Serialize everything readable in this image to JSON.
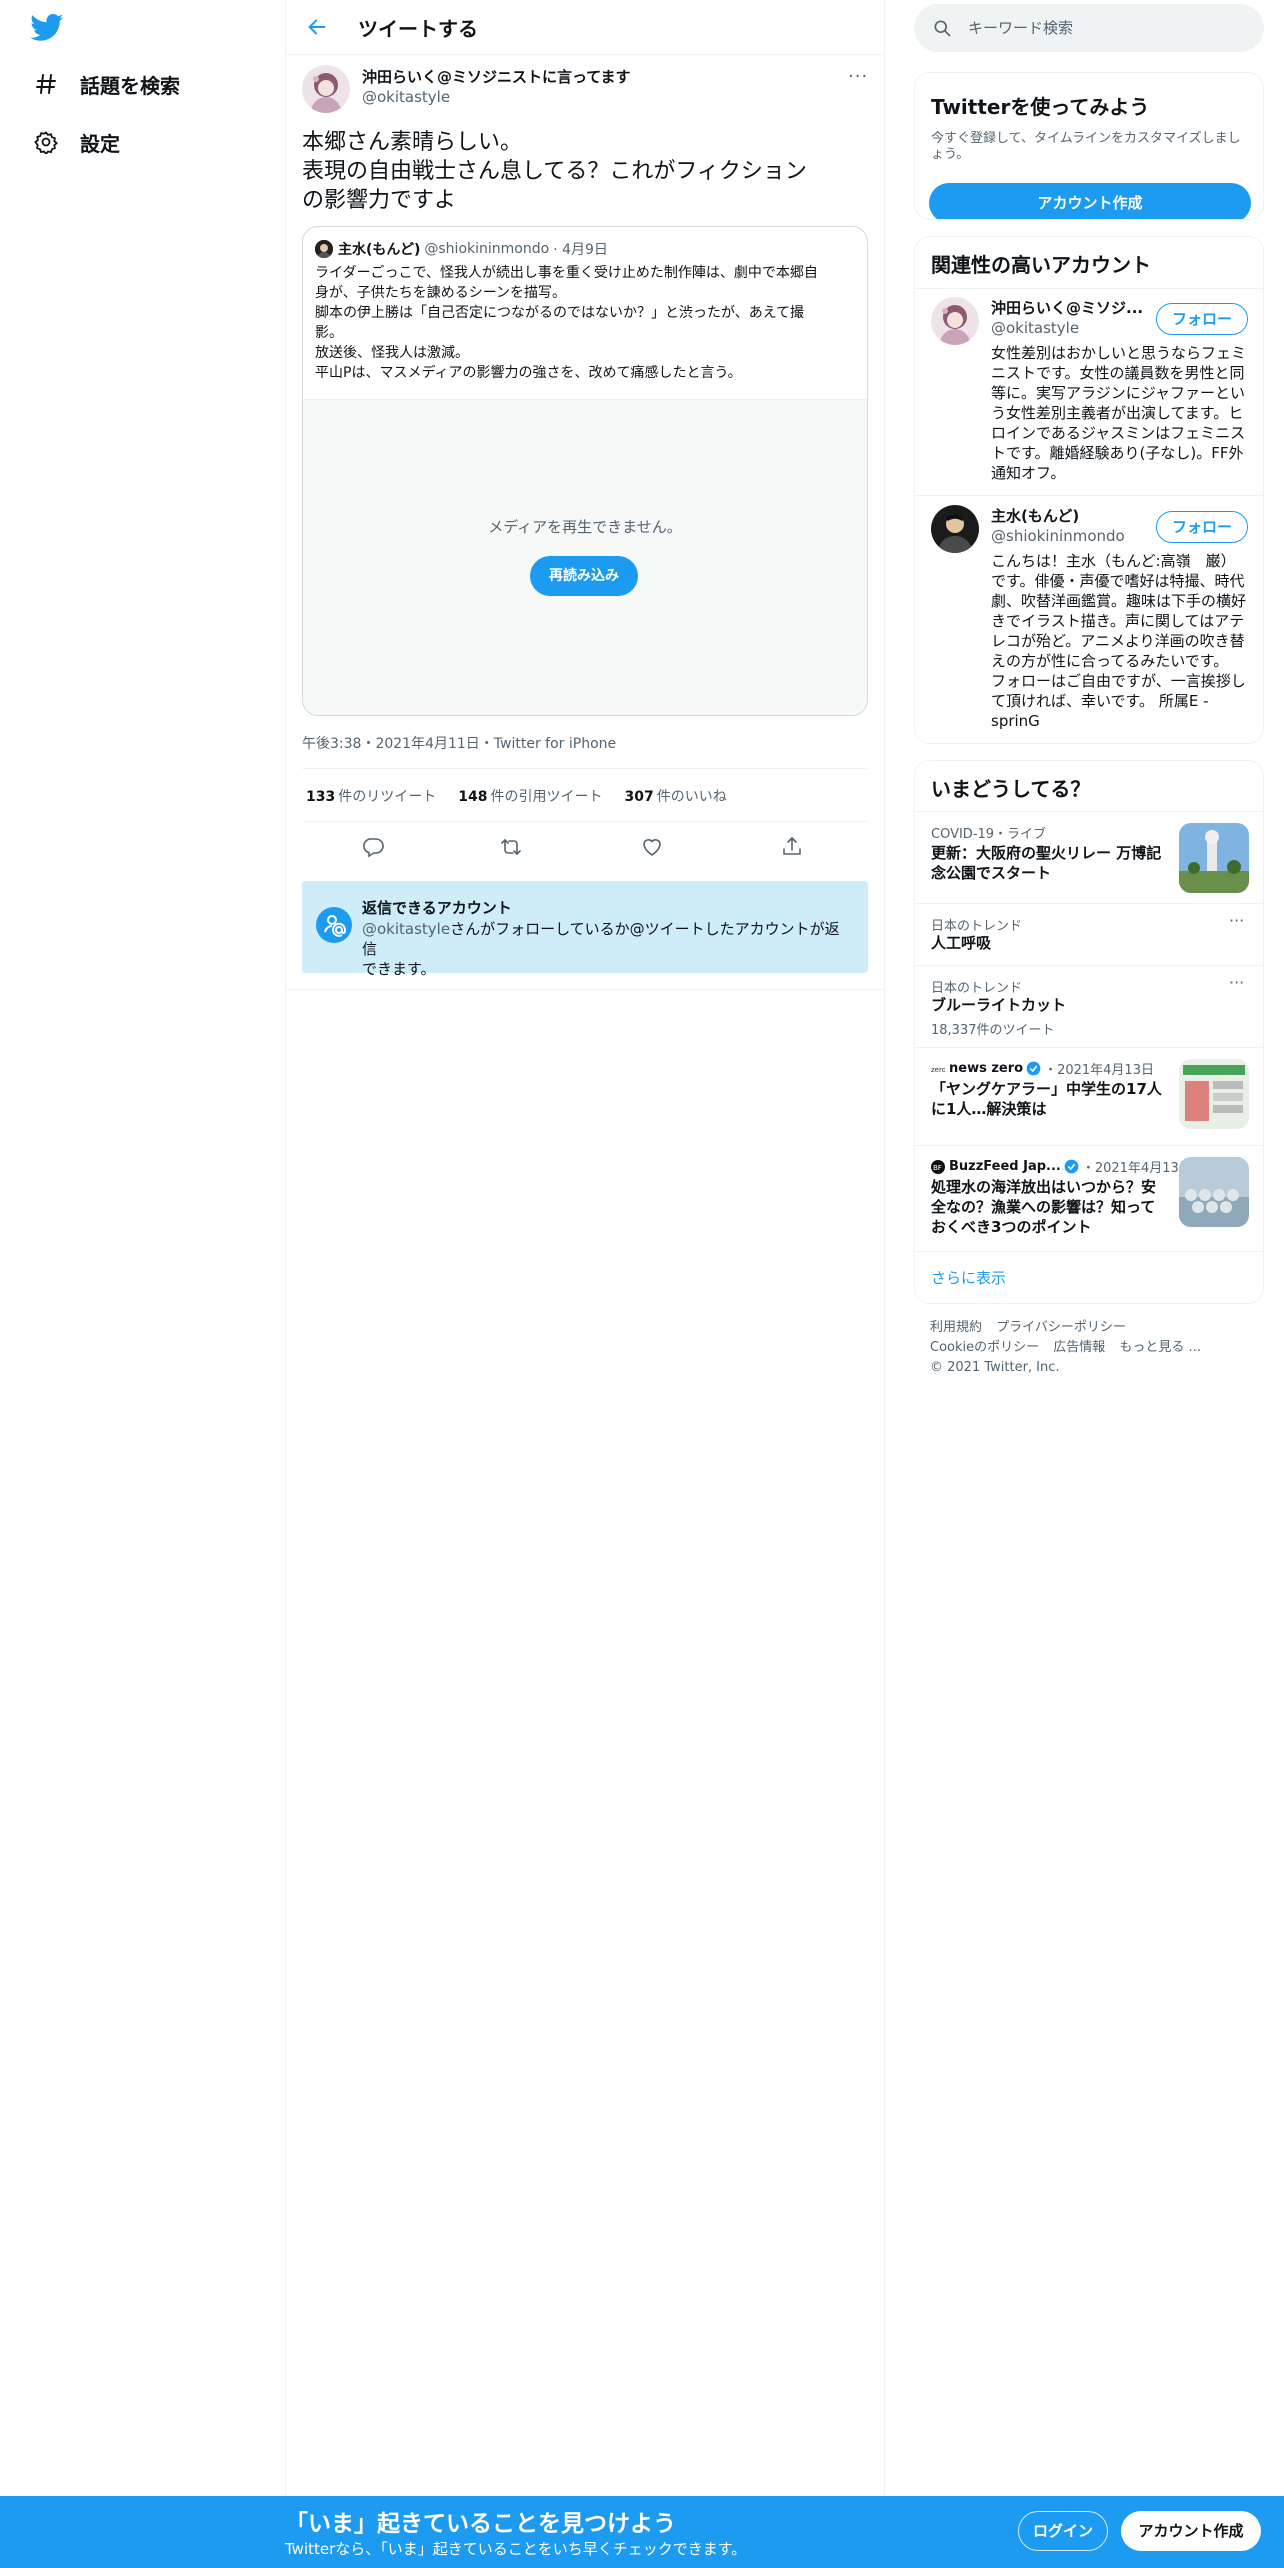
{
  "nav": {
    "items": [
      {
        "label": "話題を検索"
      },
      {
        "label": "設定"
      }
    ]
  },
  "header": {
    "title": "ツイートする"
  },
  "tweet": {
    "author_name": "沖田らいく@ミソジニストに言ってます",
    "author_handle": "@okitastyle",
    "more": "···",
    "text_lines": [
      "本郷さん素晴らしい。",
      "表現の自由戦士さん息してる？これがフィクション",
      "の影響力ですよ"
    ],
    "quote": {
      "name": "主水(もんど)",
      "handle": "@shiokininmondo",
      "date": "· 4月9日",
      "text_lines": [
        "ライダーごっこで、怪我人が続出し事を重く受け止めた制作陣は、劇中で本郷自",
        "身が、子供たちを諌めるシーンを描写。",
        "脚本の伊上勝は「自己否定につながるのではないか？」と渋ったが、あえて撮",
        "影。",
        "放送後、怪我人は激減。",
        "平山Pは、マスメディアの影響力の強さを、改めて痛感したと言う。"
      ],
      "media_message": "メディアを再生できません。",
      "reload_label": "再読み込み"
    },
    "meta": "午後3:38・2021年4月11日・Twitter for iPhone",
    "stats": {
      "retweets": "133",
      "retweets_label": "件のリツイート",
      "quotes": "148",
      "quotes_label": "件の引用ツイート",
      "likes": "307",
      "likes_label": "件のいいね"
    },
    "reply_box": {
      "title": "返信できるアカウント",
      "handle": "@okitastyle",
      "desc_rest": "さんがフォローしているか@ツイートしたアカウントが返信",
      "desc_line2": "できます。"
    }
  },
  "search": {
    "placeholder": "キーワード検索"
  },
  "signup_card": {
    "title": "Twitterを使ってみよう",
    "desc": "今すぐ登録して、タイムラインをカスタマイズしましょう。",
    "button": "アカウント作成"
  },
  "related": {
    "title": "関連性の高いアカウント",
    "follow_label": "フォロー",
    "accounts": [
      {
        "name": "沖田らいく@ミソジ...",
        "handle": "@okitastyle",
        "bio_lines": [
          "女性差別はおかしいと思うならフェミ",
          "ニストです。女性の議員数を男性と同",
          "等に。実写アラジンにジャファーとい",
          "う女性差別主義者が出演してます。ヒ",
          "ロインであるジャスミンはフェミニス",
          "トです。離婚経験あり(子なし)。FF外",
          "通知オフ。"
        ]
      },
      {
        "name": "主水(もんど)",
        "handle": "@shiokininmondo",
        "bio_lines": [
          "こんちは！主水（もんど:高嶺　巌）",
          "です。俳優・声優で嗜好は特撮、時代",
          "劇、吹替洋画鑑賞。趣味は下手の横好",
          "きでイラスト描き。声に関してはアテ",
          "レコが殆ど。アニメより洋画の吹き替",
          "えの方が性に合ってるみたいです。",
          "フォローはご自由ですが、一言挨拶し",
          "て頂ければ、幸いです。 所属E -",
          "sprinG"
        ]
      }
    ]
  },
  "trends": {
    "title": "いまどうしてる？",
    "items": [
      {
        "context": "COVID-19・ライブ",
        "title_lines": [
          "更新：大阪府の聖火リレー 万博記",
          "念公園でスタート"
        ]
      },
      {
        "context": "日本のトレンド",
        "title_lines": [
          "人工呼吸"
        ]
      },
      {
        "context": "日本のトレンド",
        "title_lines": [
          "ブルーライトカット"
        ],
        "count": "18,337件のツイート"
      },
      {
        "source": "news zero",
        "date": "・2021年4月13日",
        "title_lines": [
          "「ヤングケアラー」中学生の17人",
          "に1人…解決策は"
        ]
      },
      {
        "source": "BuzzFeed Jap...",
        "date": "・2021年4月13日",
        "title_lines": [
          "処理水の海洋放出はいつから？安",
          "全なの？漁業への影響は？知って",
          "おくべき3つのポイント"
        ]
      }
    ],
    "more_dots": "···",
    "show_more": "さらに表示"
  },
  "footer": {
    "links_line1": [
      "利用規約",
      "プライバシーポリシー"
    ],
    "links_line2": [
      "Cookieのポリシー",
      "広告情報",
      "もっと見る ..."
    ],
    "copyright": "© 2021 Twitter, Inc."
  },
  "bottom_bar": {
    "title": "「いま」起きていることを見つけよう",
    "subtitle": "Twitterなら、「いま」起きていることをいち早くチェックできます。",
    "login": "ログイン",
    "signup": "アカウント作成"
  },
  "colors": {
    "accent": "#1d9bf0",
    "text": "#0f1419",
    "muted": "#536471",
    "border": "#eff3f4",
    "reply_box_bg": "#cfecf9"
  },
  "icons": {
    "logo": "twitter-bird-icon",
    "explore": "hashtag-icon",
    "settings": "gear-icon",
    "back": "arrow-left-icon",
    "reply": "comment-icon",
    "retweet": "retweet-icon",
    "like": "heart-icon",
    "share": "share-icon",
    "search": "search-icon",
    "verified": "verified-badge-icon"
  }
}
